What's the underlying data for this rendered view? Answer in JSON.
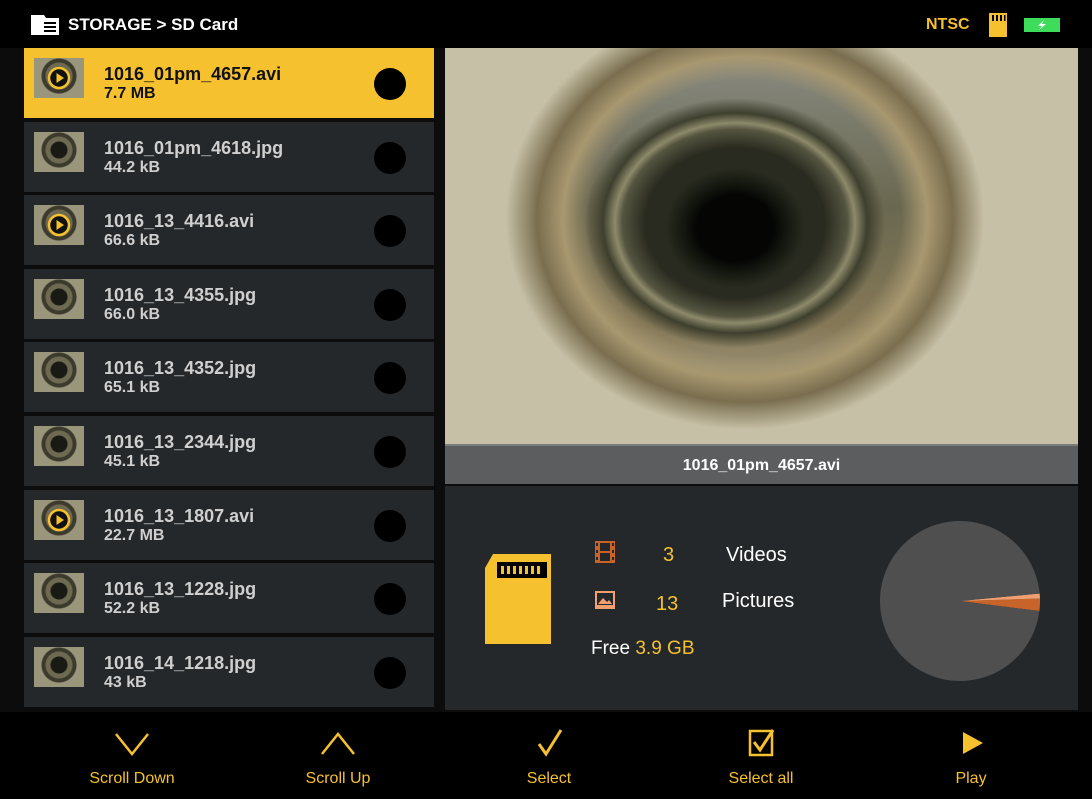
{
  "header": {
    "breadcrumb": "STORAGE > SD Card",
    "video_standard": "NTSC",
    "icons": [
      "folder-sd-icon",
      "sd-card-icon",
      "battery-icon"
    ]
  },
  "files": [
    {
      "name": "1016_01pm_4657.avi",
      "size": "7.7 MB",
      "type": "video",
      "selected": true
    },
    {
      "name": "1016_01pm_4618.jpg",
      "size": "44.2 kB",
      "type": "image",
      "selected": false
    },
    {
      "name": "1016_13_4416.avi",
      "size": "66.6 kB",
      "type": "video",
      "selected": false
    },
    {
      "name": "1016_13_4355.jpg",
      "size": "66.0 kB",
      "type": "image",
      "selected": false
    },
    {
      "name": "1016_13_4352.jpg",
      "size": "65.1 kB",
      "type": "image",
      "selected": false
    },
    {
      "name": "1016_13_2344.jpg",
      "size": "45.1 kB",
      "type": "image",
      "selected": false
    },
    {
      "name": "1016_13_1807.avi",
      "size": "22.7 MB",
      "type": "video",
      "selected": false
    },
    {
      "name": "1016_13_1228.jpg",
      "size": "52.2 kB",
      "type": "image",
      "selected": false
    },
    {
      "name": "1016_14_1218.jpg",
      "size": "43 kB",
      "type": "image",
      "selected": false
    }
  ],
  "preview": {
    "caption": "1016_01pm_4657.avi"
  },
  "storage": {
    "videos_count": "3",
    "videos_label": "Videos",
    "pictures_count": "13",
    "pictures_label": "Pictures",
    "free_label": "Free",
    "free_value": "3.9 GB",
    "usage_fractions": {
      "free": 0.965,
      "videos": 0.025,
      "pictures": 0.01
    }
  },
  "toolbar": {
    "scroll_down": "Scroll Down",
    "scroll_up": "Scroll Up",
    "select": "Select",
    "select_all": "Select all",
    "play": "Play"
  },
  "colors": {
    "accent": "#f5c12e",
    "panel": "#25282a",
    "videos_slice": "#c8642a",
    "pictures_slice": "#f0a070",
    "free_slice": "#4f4f4f"
  }
}
